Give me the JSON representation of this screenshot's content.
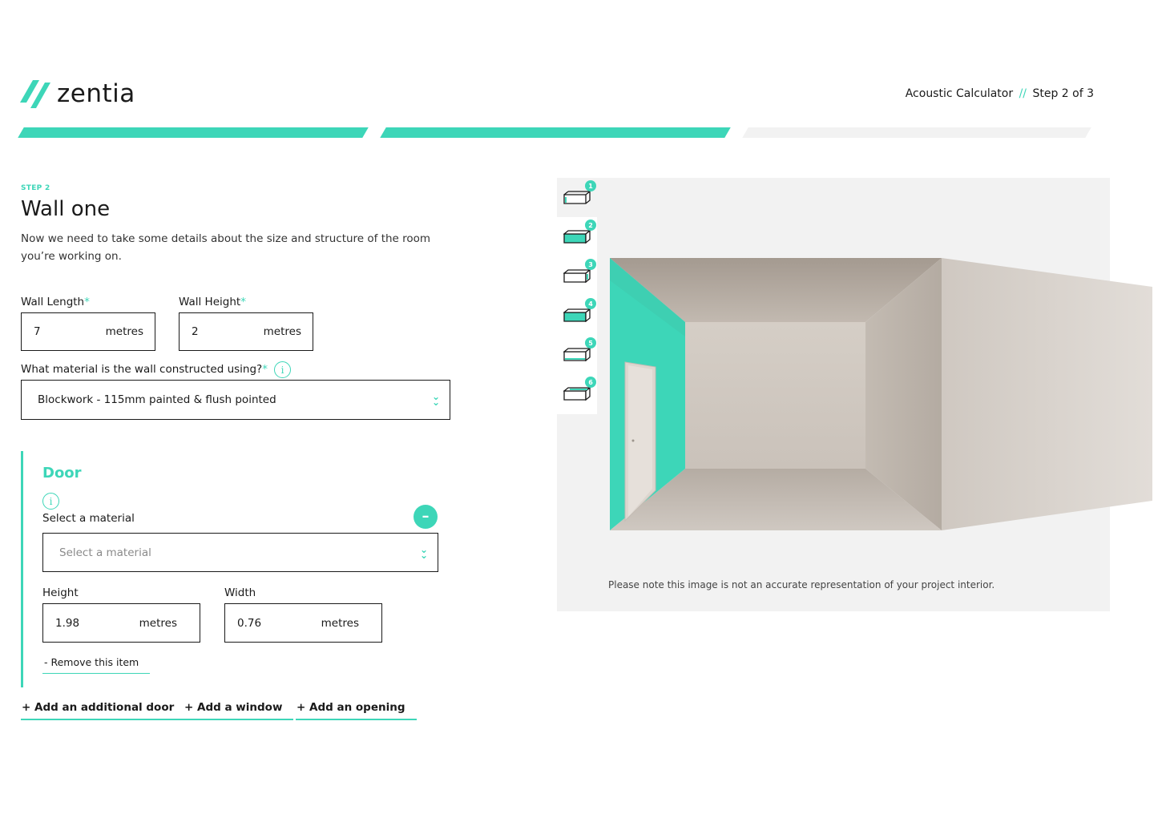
{
  "brand": {
    "name": "zentia",
    "accent_color": "#3dd6b8"
  },
  "header": {
    "calculator_label": "Acoustic Calculator",
    "separator": "//",
    "step_indicator": "Step 2 of 3"
  },
  "progress": {
    "steps_total": 3,
    "steps_completed": 2
  },
  "step_label": "STEP 2",
  "title": "Wall one",
  "intro": "Now we need to take some details about the size and structure of the room you’re working on.",
  "wall_length": {
    "label": "Wall Length",
    "required_mark": "*",
    "value": "7",
    "unit": "metres"
  },
  "wall_height": {
    "label": "Wall Height",
    "required_mark": "*",
    "value": "2",
    "unit": "metres"
  },
  "material_question": {
    "label": "What material is the wall constructed using?",
    "required_mark": "*",
    "info_icon": "info-icon"
  },
  "wall_material": {
    "value": "Blockwork - 115mm painted & flush pointed",
    "chevron_icon": "double-chevron-down-icon"
  },
  "door": {
    "title": "Door",
    "select_label": "Select a material",
    "select_placeholder": "Select a material",
    "height": {
      "label": "Height",
      "value": "1.98",
      "unit": "metres"
    },
    "width": {
      "label": "Width",
      "value": "0.76",
      "unit": "metres"
    },
    "collapse_symbol": "–",
    "remove_label": "-  Remove this item"
  },
  "add_links": {
    "door": "+ Add an additional door",
    "window": "+ Add a window",
    "opening": "+ Add an opening"
  },
  "wall_tabs": [
    {
      "number": "1",
      "active": true
    },
    {
      "number": "2",
      "active": false
    },
    {
      "number": "3",
      "active": false
    },
    {
      "number": "4",
      "active": false
    },
    {
      "number": "5",
      "active": false
    },
    {
      "number": "6",
      "active": false
    }
  ],
  "disclaimer": "Please note this image is not an accurate representation of your project interior."
}
